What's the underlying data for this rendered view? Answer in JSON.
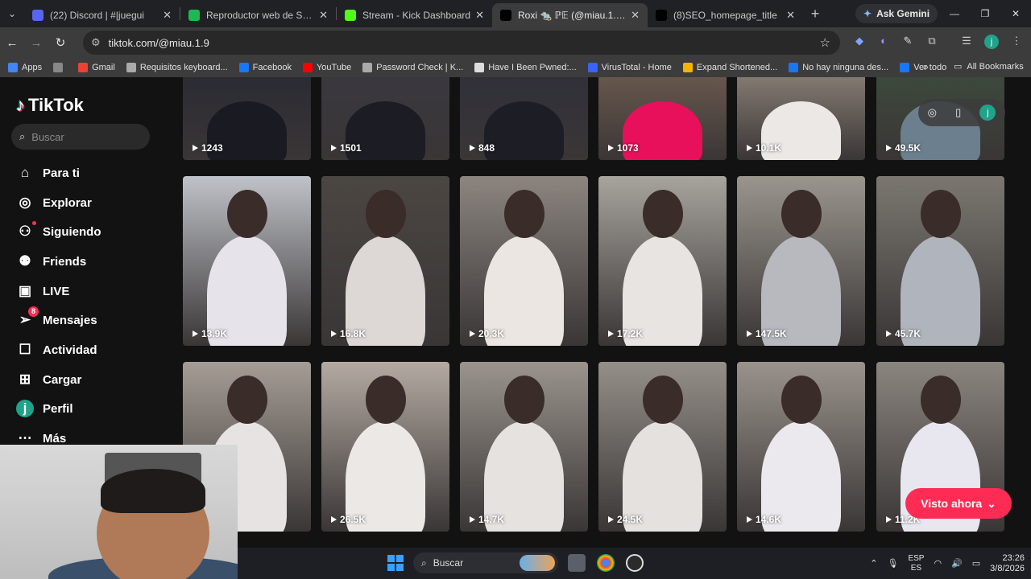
{
  "browser": {
    "tabs": [
      {
        "title": "(22) Discord | #|juegui",
        "favicon_color": "#5865F2",
        "badge": "22"
      },
      {
        "title": "Reproductor web de Spotify: ",
        "favicon_color": "#1DB954"
      },
      {
        "title": "Stream - Kick Dashboard",
        "favicon_color": "#53FC18"
      },
      {
        "title": "Roxi 🐀 ℙ𝔼 (@miau.1.9) | TikTok",
        "favicon_color": "#000000",
        "active": true
      },
      {
        "title": "(8)SEO_homepage_title",
        "favicon_color": "#000000"
      }
    ],
    "gemini_label": "Ask Gemini",
    "address": "tiktok.com/@miau.1.9",
    "profile_initial": "j",
    "bookmarks": [
      {
        "label": "Apps",
        "color": "#4285F4"
      },
      {
        "label": "",
        "color": "#888888"
      },
      {
        "label": "Gmail",
        "color": "#EA4335"
      },
      {
        "label": "Requisitos keyboard...",
        "color": "#aaaaaa"
      },
      {
        "label": "Facebook",
        "color": "#1877F2"
      },
      {
        "label": "YouTube",
        "color": "#FF0000"
      },
      {
        "label": "Password Check | K...",
        "color": "#aaaaaa"
      },
      {
        "label": "Have I Been Pwned:...",
        "color": "#dddddd"
      },
      {
        "label": "VirusTotal - Home",
        "color": "#3b61ff"
      },
      {
        "label": "Expand Shortened...",
        "color": "#f4b400"
      },
      {
        "label": "No hay ninguna des...",
        "color": "#1877F2"
      },
      {
        "label": "Ver todo",
        "color": "#1877F2"
      }
    ],
    "all_bookmarks": "All Bookmarks",
    "more": "»"
  },
  "tiktok": {
    "logo": "TikTok",
    "search_placeholder": "Buscar",
    "nav": [
      {
        "label": "Para ti",
        "icon": "home-icon"
      },
      {
        "label": "Explorar",
        "icon": "compass-icon"
      },
      {
        "label": "Siguiendo",
        "icon": "following-icon"
      },
      {
        "label": "Friends",
        "icon": "friends-icon"
      },
      {
        "label": "LIVE",
        "icon": "live-icon"
      },
      {
        "label": "Mensajes",
        "icon": "messages-icon",
        "badge": "8"
      },
      {
        "label": "Actividad",
        "icon": "activity-icon"
      },
      {
        "label": "Cargar",
        "icon": "upload-icon"
      },
      {
        "label": "Perfil",
        "icon": "profile-icon",
        "initial": "j"
      },
      {
        "label": "Más",
        "icon": "more-icon"
      }
    ],
    "videos": [
      {
        "views": "1243",
        "bg": "#2a2a33",
        "fg": "#1a1a22"
      },
      {
        "views": "1501",
        "bg": "#3a3840",
        "fg": "#1c1c24"
      },
      {
        "views": "848",
        "bg": "#30303a",
        "fg": "#1d1d26"
      },
      {
        "views": "1073",
        "bg": "#6b5a4f",
        "fg": "#e8105a"
      },
      {
        "views": "10.1K",
        "bg": "#8a8076",
        "fg": "#ece8e6"
      },
      {
        "views": "49.5K",
        "bg": "#3d4a3d",
        "fg": "#6b7f8e"
      },
      {
        "views": "13.9K",
        "bg": "#bfc2c8",
        "fg": "#e6e3ea"
      },
      {
        "views": "16.8K",
        "bg": "#4b4642",
        "fg": "#ddd8d6"
      },
      {
        "views": "20.3K",
        "bg": "#8c8580",
        "fg": "#ece6e2"
      },
      {
        "views": "17.2K",
        "bg": "#a7a39d",
        "fg": "#e8e4e2"
      },
      {
        "views": "147.5K",
        "bg": "#9a958d",
        "fg": "#b7b9bf"
      },
      {
        "views": "45.7K",
        "bg": "#7b7770",
        "fg": "#b0b4bc"
      },
      {
        "views": "",
        "bg": "#a59d95",
        "fg": "#e7e3e2"
      },
      {
        "views": "26.5K",
        "bg": "#b4aaa2",
        "fg": "#ece8e6"
      },
      {
        "views": "14.7K",
        "bg": "#9a948d",
        "fg": "#e6e2e0"
      },
      {
        "views": "24.5K",
        "bg": "#948f88",
        "fg": "#e5e1df"
      },
      {
        "views": "14.6K",
        "bg": "#9a938c",
        "fg": "#ebe8ee"
      },
      {
        "views": "11.2K",
        "bg": "#8b857f",
        "fg": "#e8e6ee"
      }
    ],
    "visto_ahora": "Visto ahora",
    "overlay_initial": "j"
  },
  "taskbar": {
    "search_placeholder": "Buscar",
    "lang_top": "ESP",
    "lang_bottom": "ES",
    "time": "23:26",
    "date": "3/8/2026"
  }
}
